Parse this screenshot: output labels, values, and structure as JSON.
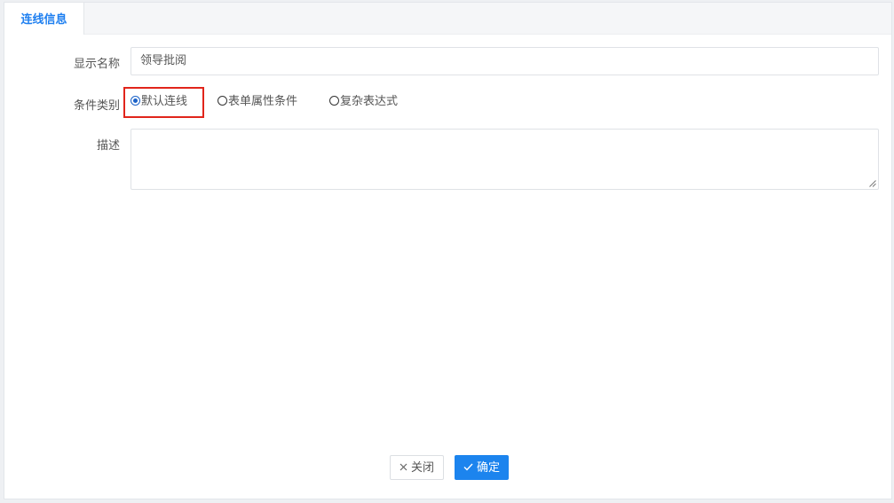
{
  "tabs": [
    {
      "label": "连线信息",
      "active": true
    }
  ],
  "form": {
    "display_name": {
      "label": "显示名称",
      "value": "领导批阅"
    },
    "condition_type": {
      "label": "条件类别",
      "options": [
        {
          "label": "默认连线",
          "checked": true
        },
        {
          "label": "表单属性条件",
          "checked": false
        },
        {
          "label": "复杂表达式",
          "checked": false
        }
      ]
    },
    "description": {
      "label": "描述",
      "value": ""
    }
  },
  "buttons": {
    "close": {
      "label": "关闭",
      "icon": "close-icon"
    },
    "confirm": {
      "label": "确定",
      "icon": "check-icon"
    }
  },
  "colors": {
    "accent": "#1c84ee",
    "tab_active_text": "#1e7ff0",
    "highlight_border": "#e1251b"
  }
}
